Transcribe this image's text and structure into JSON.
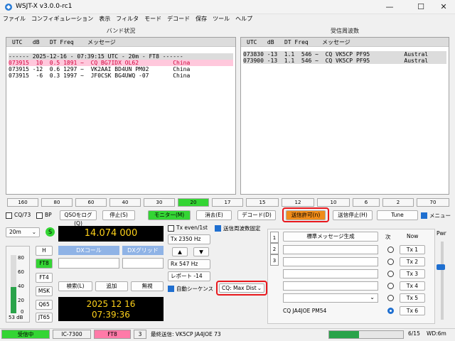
{
  "window": {
    "title": "WSJT-X   v3.0.0-rc1",
    "min": "—",
    "max": "☐",
    "close": "✕"
  },
  "menu": [
    "ファイル",
    "コンフィギュレーション",
    "表示",
    "フィルタ",
    "モード",
    "デコード",
    "保存",
    "ツール",
    "ヘルプ"
  ],
  "band_activity": {
    "title": "バンド状況",
    "header": "UTC   dB   DT Freq    メッセージ",
    "separator": "------ 2025-12-16 - 07:39:15 UTC - 20m - FT8 ------",
    "lines": [
      {
        "text": "073915  10  0.5 1891 ~  CQ BG7IDX OL62          China",
        "hl": true
      },
      {
        "text": "073915 -12  0.6 1297 ~  VK2AAI BD4UN PM02       China",
        "hl": false
      },
      {
        "text": "073915  -6  0.3 1997 ~  JF0CSK BG4UWQ -07       China",
        "hl": false
      }
    ]
  },
  "rx_frequency": {
    "title": "受信周波数",
    "header": "UTC   dB   DT Freq    メッセージ",
    "lines": [
      "073830 -13  1.1  546 ~  CQ VK5CP PF95          Austral",
      "073900 -13  1.1  546 ~  CQ VK5CP PF95          Austral"
    ]
  },
  "bands": [
    "160",
    "80",
    "60",
    "40",
    "30",
    "20",
    "17",
    "15",
    "12",
    "10",
    "6",
    "2",
    "70"
  ],
  "active_band": "20",
  "controls": {
    "cq73": "CQ/73",
    "bp": "BP",
    "log_qso": "QSOをログ(Q)",
    "stop": "停止(S)",
    "monitor": "モニター(M)",
    "erase": "消去(E)",
    "decode": "デコード(D)",
    "enable_tx": "送信許可(n)",
    "halt_tx": "送信停止(H)",
    "tune": "Tune",
    "menus": "メニュー"
  },
  "left": {
    "band_select": "20m",
    "s_icon": "S",
    "dial_freq": "14.074 000",
    "modes": [
      "H",
      "FT8",
      "FT4",
      "MSK",
      "Q65",
      "JT65"
    ],
    "active_mode": "FT8",
    "meter_ticks": [
      "80",
      "60",
      "40",
      "20",
      "0"
    ],
    "meter_db": "53 dB",
    "meter_level": 0.45
  },
  "dx": {
    "call_label": "DXコール",
    "grid_label": "DXグリッド",
    "search": "検索(L)",
    "add": "追加",
    "ignore": "無視",
    "date": "2025 12 16",
    "time": "07:39:36"
  },
  "mid": {
    "tx_even": "Tx even/1st",
    "tx_freq": "Tx  2350  Hz",
    "rx_freq": "Rx  547  Hz",
    "report": "レポート -14",
    "auto_seq": "自動シーケンス",
    "hold_tx": "送信周波数固定",
    "cq_mode": "CQ: Max Dist"
  },
  "tx_panel": {
    "gen_std": "標準メッセージ生成",
    "next": "次",
    "now": "Now",
    "tx_buttons": [
      "Tx 1",
      "Tx 2",
      "Tx 3",
      "Tx 4",
      "Tx 5",
      "Tx 6"
    ],
    "tx6_msg": "CQ JA4JOE PM54",
    "pwr": "Pwr",
    "tabs": [
      "1",
      "2",
      "3"
    ]
  },
  "status": {
    "receiving": "受信中",
    "rig": "IC-7300",
    "mode": "FT8",
    "num": "3",
    "last_tx": "最終送信: VK5CP JA4JOE 73",
    "progress_text": "6/15",
    "progress": 0.4,
    "wd": "WD:6m"
  },
  "colors": {
    "monitor": "#34d534",
    "enable_tx": "#f08c1a",
    "highlight": "#e8181d",
    "dial_bg": "#000000",
    "dial_fg": "#ffd21a",
    "receiving": "#34d534",
    "mode_pink": "#ff7aa8",
    "hl_line": "#ffc8dc"
  }
}
